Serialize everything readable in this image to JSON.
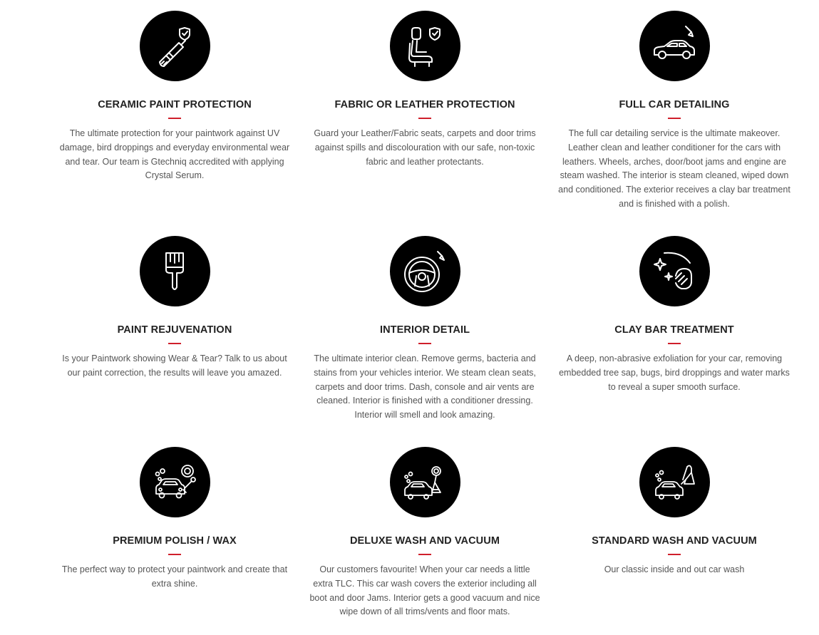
{
  "accent_color": "#cf1f2b",
  "services": [
    {
      "icon": "paintbrush-shield-icon",
      "title": "CERAMIC PAINT PROTECTION",
      "description": "The ultimate protection for your paintwork against UV damage, bird droppings and everyday environmental wear and tear. Our team is Gtechniq accredited with applying Crystal Serum."
    },
    {
      "icon": "car-seat-shield-icon",
      "title": "FABRIC OR LEATHER PROTECTION",
      "description": "Guard your Leather/Fabric seats, carpets and door trims against spills and discolouration with our safe, non-toxic fabric and leather protectants."
    },
    {
      "icon": "car-brush-icon",
      "title": "FULL CAR DETAILING",
      "description": "The full car detailing service is the ultimate makeover. Leather clean and leather conditioner for the cars with leathers. Wheels, arches, door/boot jams and engine are steam washed. The interior is steam cleaned, wiped down and conditioned. The exterior receives a clay bar treatment and is finished with a polish."
    },
    {
      "icon": "paintbrush-icon",
      "title": "PAINT REJUVENATION",
      "description": "Is your Paintwork showing Wear & Tear? Talk to us about our paint correction, the results will leave you amazed."
    },
    {
      "icon": "steering-wheel-icon",
      "title": "INTERIOR DETAIL",
      "description": "The ultimate interior clean. Remove germs, bacteria and stains from your vehicles interior. We steam clean seats, carpets and door trims. Dash, console and air vents are cleaned. Interior is finished with a conditioner dressing. Interior will smell and look amazing."
    },
    {
      "icon": "sparkle-hand-icon",
      "title": "CLAY BAR TREATMENT",
      "description": "A deep, non-abrasive exfoliation for your car, removing embedded tree sap, bugs, bird droppings and water marks to reveal a super smooth surface."
    },
    {
      "icon": "car-wash-polish-icon",
      "title": "PREMIUM POLISH / WAX",
      "description": "The perfect way to protect your paintwork and create that extra shine."
    },
    {
      "icon": "car-wash-vacuum-polish-icon",
      "title": "DELUXE WASH AND VACUUM",
      "description": "Our customers favourite! When your car needs a little extra TLC. This car wash covers the exterior including all boot and door Jams. Interior gets a good vacuum and nice wipe down of all trims/vents and floor mats."
    },
    {
      "icon": "car-wash-vacuum-icon",
      "title": "STANDARD WASH AND VACUUM",
      "description": "Our classic inside and out car wash"
    }
  ]
}
